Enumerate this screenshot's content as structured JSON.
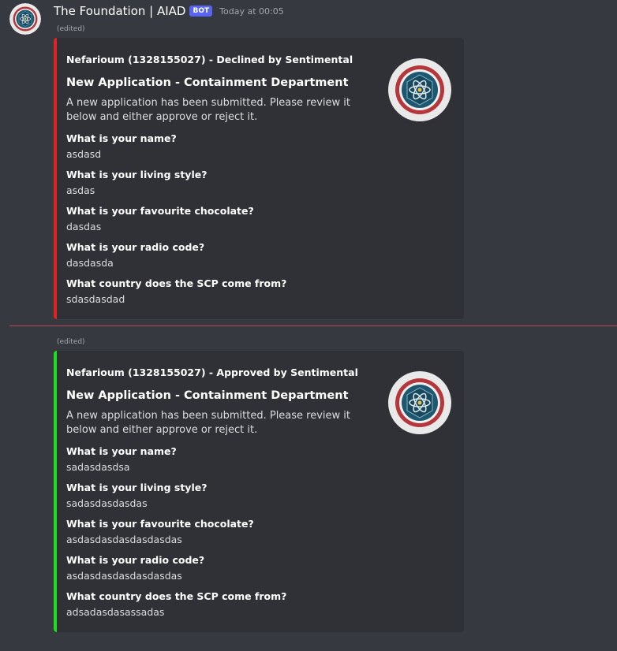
{
  "message": {
    "username": "The Foundation | AIAD",
    "bot_tag": "BOT",
    "timestamp": "Today at 00:05",
    "avatar_icon": "foundation-seal-icon"
  },
  "embeds": [
    {
      "edited_label": "(edited)",
      "accent_color": "#e02424",
      "author": "Nefarioum (1328155027) - Declined by Sentimental",
      "title": "New Application - Containment Department",
      "description": "A new application has been submitted. Please review it below and either approve or reject it.",
      "thumbnail_icon": "foundation-seal-icon",
      "fields": [
        {
          "name": "What is your name?",
          "value": "asdasd"
        },
        {
          "name": "What is your living style?",
          "value": "asdas"
        },
        {
          "name": "What is your favourite chocolate?",
          "value": "dasdas"
        },
        {
          "name": "What is your radio code?",
          "value": "dasdasda"
        },
        {
          "name": "What country does the SCP come from?",
          "value": "sdasdasdad"
        }
      ]
    },
    {
      "edited_label": "(edited)",
      "accent_color": "#1edf1e",
      "author": "Nefarioum (1328155027) - Approved by Sentimental",
      "title": "New Application - Containment Department",
      "description": "A new application has been submitted. Please review it below and either approve or reject it.",
      "thumbnail_icon": "foundation-seal-icon",
      "fields": [
        {
          "name": "What is your name?",
          "value": "sadasdasdsa"
        },
        {
          "name": "What is your living style?",
          "value": "sadasdasdasdas"
        },
        {
          "name": "What is your favourite chocolate?",
          "value": "asdasdasdasdasdasdas"
        },
        {
          "name": "What is your radio code?",
          "value": "asdasdasdasdasdasdas"
        },
        {
          "name": "What country does the SCP come from?",
          "value": "adsadasdasassadas"
        }
      ]
    }
  ]
}
